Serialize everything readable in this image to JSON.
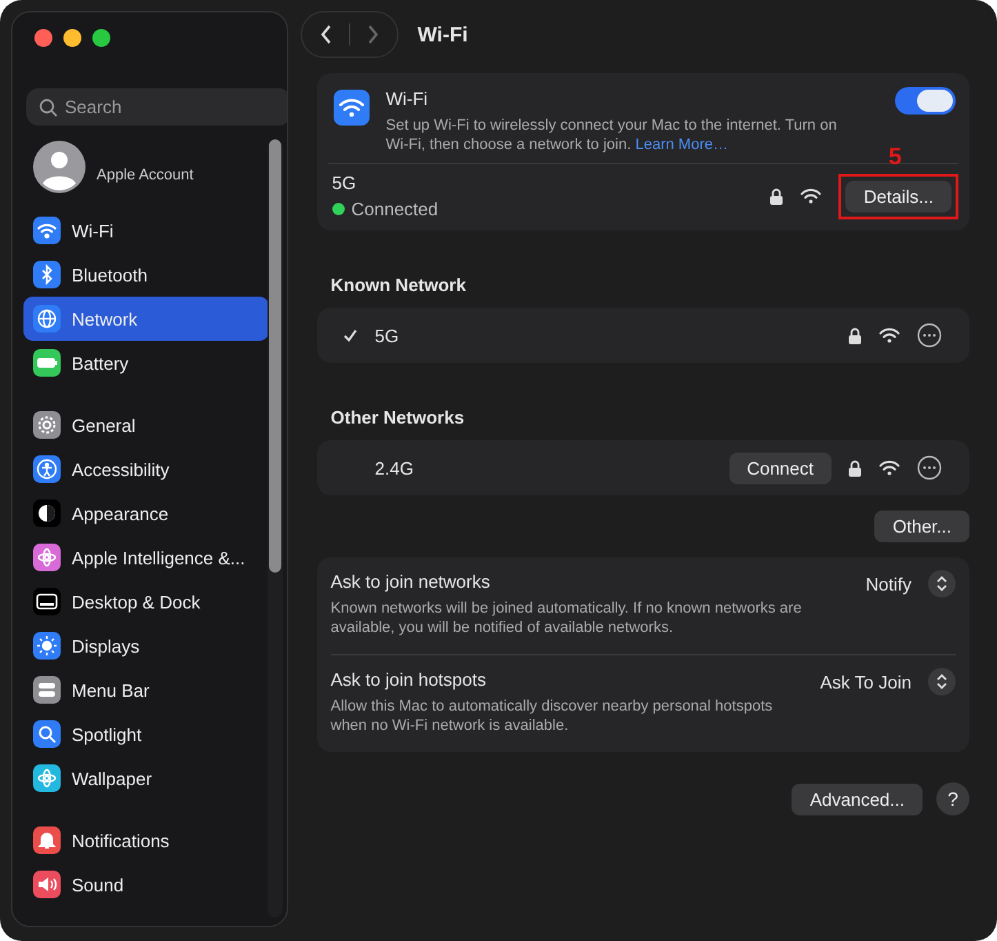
{
  "sidebar": {
    "search": {
      "placeholder": "Search"
    },
    "account": {
      "label": "Apple Account"
    },
    "groups": [
      [
        {
          "label": "Wi-Fi",
          "kind": "wifi",
          "color": "#2f7cf6",
          "selected": false
        },
        {
          "label": "Bluetooth",
          "kind": "bluetooth",
          "color": "#2f7cf6",
          "selected": false
        },
        {
          "label": "Network",
          "kind": "globe",
          "color": "#2f7cf6",
          "selected": true
        },
        {
          "label": "Battery",
          "kind": "battery",
          "color": "#34c759",
          "selected": false
        }
      ],
      [
        {
          "label": "General",
          "kind": "gear",
          "color": "#8e8e93",
          "selected": false
        },
        {
          "label": "Accessibility",
          "kind": "person",
          "color": "#2f7cf6",
          "selected": false
        },
        {
          "label": "Appearance",
          "kind": "contrast",
          "color": "#000000",
          "selected": false
        },
        {
          "label": "Apple Intelligence &...",
          "kind": "flower",
          "color": "#d86bd8",
          "selected": false
        },
        {
          "label": "Desktop & Dock",
          "kind": "dock",
          "color": "#000000",
          "selected": false
        },
        {
          "label": "Displays",
          "kind": "sun",
          "color": "#2f7cf6",
          "selected": false
        },
        {
          "label": "Menu Bar",
          "kind": "toggles",
          "color": "#8e8e93",
          "selected": false
        },
        {
          "label": "Spotlight",
          "kind": "magnifier",
          "color": "#2f7cf6",
          "selected": false
        },
        {
          "label": "Wallpaper",
          "kind": "flower",
          "color": "#22b8e0",
          "selected": false
        }
      ],
      [
        {
          "label": "Notifications",
          "kind": "bell",
          "color": "#eb4d4b",
          "selected": false
        },
        {
          "label": "Sound",
          "kind": "speaker",
          "color": "#eb4d5e",
          "selected": false
        }
      ]
    ]
  },
  "header": {
    "title": "Wi-Fi"
  },
  "wifi_card": {
    "title": "Wi-Fi",
    "description": "Set up Wi-Fi to wirelessly connect your Mac to the internet. Turn on Wi-Fi, then choose a network to join.",
    "link": "Learn More…",
    "on": true,
    "current": {
      "name": "5G",
      "status": "Connected",
      "color": "#30d158",
      "button": "Details...",
      "annotation": "5"
    }
  },
  "known_networks": {
    "heading": "Known Network",
    "items": [
      {
        "name": "5G",
        "checked": true
      }
    ]
  },
  "other_networks": {
    "heading": "Other Networks",
    "items": [
      {
        "name": "2.4G",
        "checked": false,
        "button": "Connect"
      }
    ],
    "other_button": "Other..."
  },
  "settings": [
    {
      "title": "Ask to join networks",
      "description": "Known networks will be joined automatically. If no known networks are available, you will be notified of available networks.",
      "value": "Notify"
    },
    {
      "title": "Ask to join hotspots",
      "description": "Allow this Mac to automatically discover nearby personal hotspots when no Wi-Fi network is available.",
      "value": "Ask To Join"
    }
  ],
  "footer": {
    "advanced": "Advanced...",
    "help": "?"
  }
}
